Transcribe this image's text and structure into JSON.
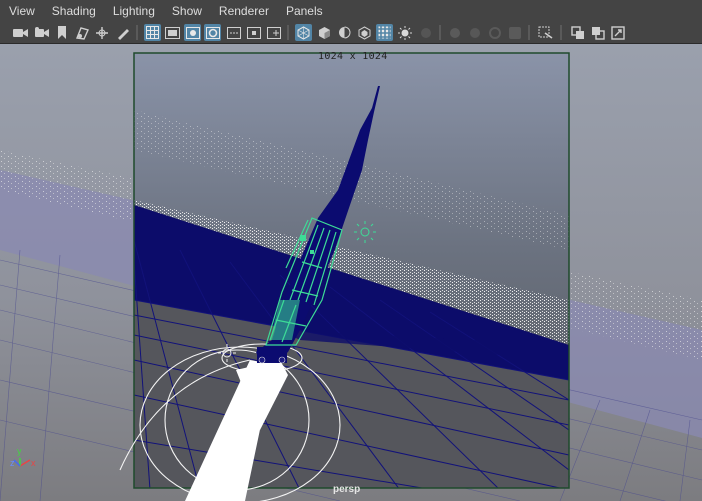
{
  "menubar": {
    "items": [
      {
        "label": "View"
      },
      {
        "label": "Shading"
      },
      {
        "label": "Lighting"
      },
      {
        "label": "Show"
      },
      {
        "label": "Renderer"
      },
      {
        "label": "Panels"
      }
    ]
  },
  "toolbar": {
    "icons": [
      "select-camera-icon",
      "camera-attributes-icon",
      "bookmark-icon",
      "image-plane-icon",
      "2d-pan-zoom-icon",
      "grease-pencil-icon",
      "grid-icon",
      "film-gate-icon",
      "resolution-gate-icon",
      "gate-mask-icon",
      "field-chart-icon",
      "safe-action-icon",
      "wireframe-icon",
      "smooth-shade-icon",
      "bounding-box-icon",
      "use-default-material-icon",
      "xray-icon",
      "use-lights-icon",
      "shadows-icon",
      "ambient-occlusion-icon",
      "motion-blur-icon",
      "antialiasing-icon",
      "depth-of-field-icon",
      "isolate-select-icon",
      "xray-joints-icon",
      "xray-active-icon",
      "camera-view-icon"
    ]
  },
  "viewport": {
    "resolution_gate_label": "1024 x 1024",
    "camera_label": "persp",
    "axis_labels": {
      "x": "x",
      "y": "y",
      "z": "z"
    }
  },
  "colors": {
    "panel_bg": "#444444",
    "active_button": "#5285a6",
    "rocket_fill": "#0a0a6e",
    "selection_green": "#3ddc97",
    "gate_border": "#204a30"
  }
}
